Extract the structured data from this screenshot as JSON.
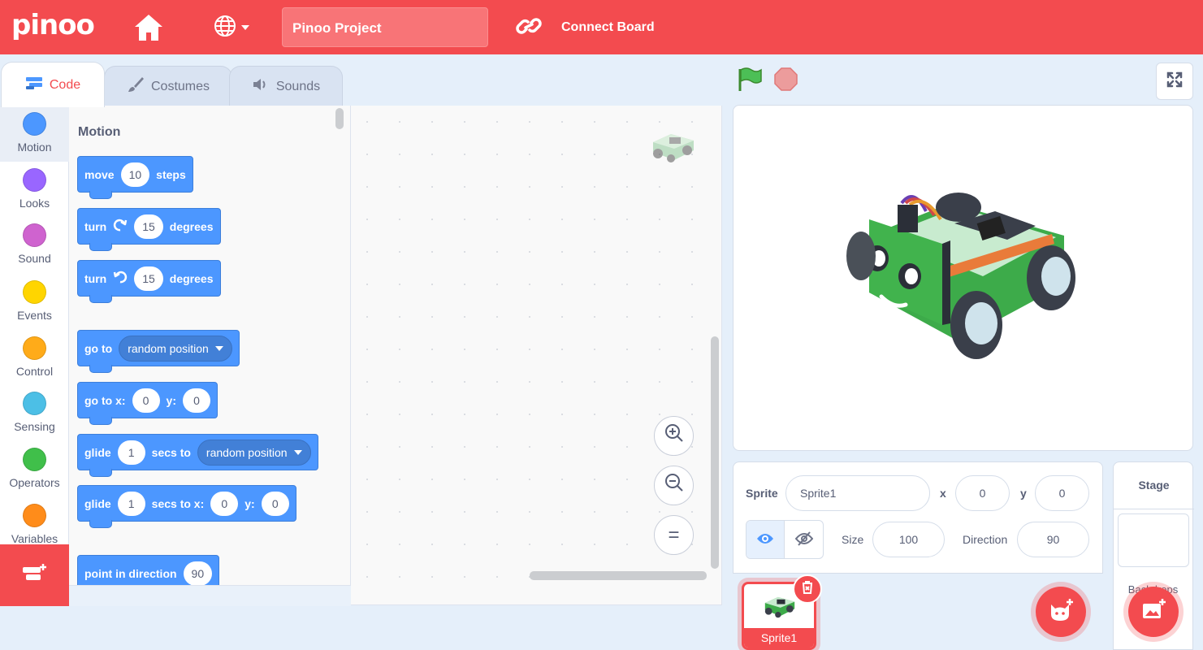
{
  "app": {
    "logo": "pinoo",
    "project_title": "Pinoo Project",
    "connect_label": "Connect Board"
  },
  "colors": {
    "brand": "#f34b4f",
    "motion": "#4c97ff"
  },
  "tabs": [
    {
      "label": "Code",
      "icon": "code-icon"
    },
    {
      "label": "Costumes",
      "icon": "brush-icon"
    },
    {
      "label": "Sounds",
      "icon": "speaker-icon"
    }
  ],
  "categories": [
    {
      "label": "Motion",
      "color": "#4c97ff"
    },
    {
      "label": "Looks",
      "color": "#9966ff"
    },
    {
      "label": "Sound",
      "color": "#cf63cf"
    },
    {
      "label": "Events",
      "color": "#ffd500"
    },
    {
      "label": "Control",
      "color": "#ffab19"
    },
    {
      "label": "Sensing",
      "color": "#4cbfe6"
    },
    {
      "label": "Operators",
      "color": "#40bf4a"
    },
    {
      "label": "Variables",
      "color": "#ff8c1a"
    }
  ],
  "palette": {
    "title": "Motion",
    "move": {
      "pre": "move",
      "val": "10",
      "post": "steps"
    },
    "turn_right": {
      "pre": "turn",
      "val": "15",
      "post": "degrees"
    },
    "turn_left": {
      "pre": "turn",
      "val": "15",
      "post": "degrees"
    },
    "goto": {
      "pre": "go to",
      "menu": "random position"
    },
    "goto_xy": {
      "pre": "go to x:",
      "x": "0",
      "ylabel": "y:",
      "y": "0"
    },
    "glide": {
      "pre": "glide",
      "val": "1",
      "mid": "secs to",
      "menu": "random position"
    },
    "glide_xy": {
      "pre": "glide",
      "val": "1",
      "mid": "secs to x:",
      "x": "0",
      "ylabel": "y:",
      "y": "0"
    },
    "point": {
      "pre": "point in direction",
      "val": "90"
    }
  },
  "zoom": {
    "in": "zoom-in-icon",
    "out": "zoom-out-icon",
    "reset": "="
  },
  "sprite": {
    "label": "Sprite",
    "name": "Sprite1",
    "x_label": "x",
    "x": "0",
    "y_label": "y",
    "y": "0",
    "size_label": "Size",
    "size": "100",
    "direction_label": "Direction",
    "direction": "90",
    "tile_name": "Sprite1"
  },
  "stage_panel": {
    "title": "Stage",
    "backdrops_label": "Backdrops"
  }
}
